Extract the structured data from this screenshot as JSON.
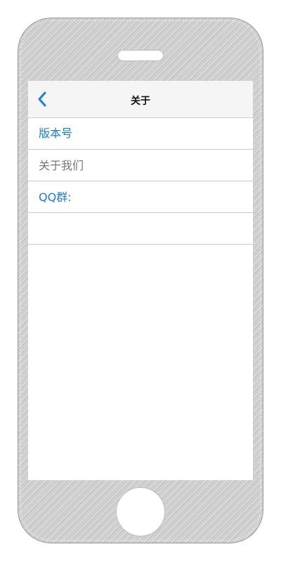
{
  "navbar": {
    "back_icon": "chevron-left-icon",
    "title": "关于"
  },
  "list": {
    "items": [
      {
        "label": "版本号",
        "color": "#1a7de0"
      },
      {
        "label": "关于我们",
        "color": "#777777"
      },
      {
        "label": "QQ群:",
        "color": "#1a7de0"
      },
      {
        "label": ""
      }
    ]
  },
  "colors": {
    "accent": "#1a7de0",
    "navbar_bg": "#f5f5f5",
    "phone_frame": "#cfcfcf"
  }
}
